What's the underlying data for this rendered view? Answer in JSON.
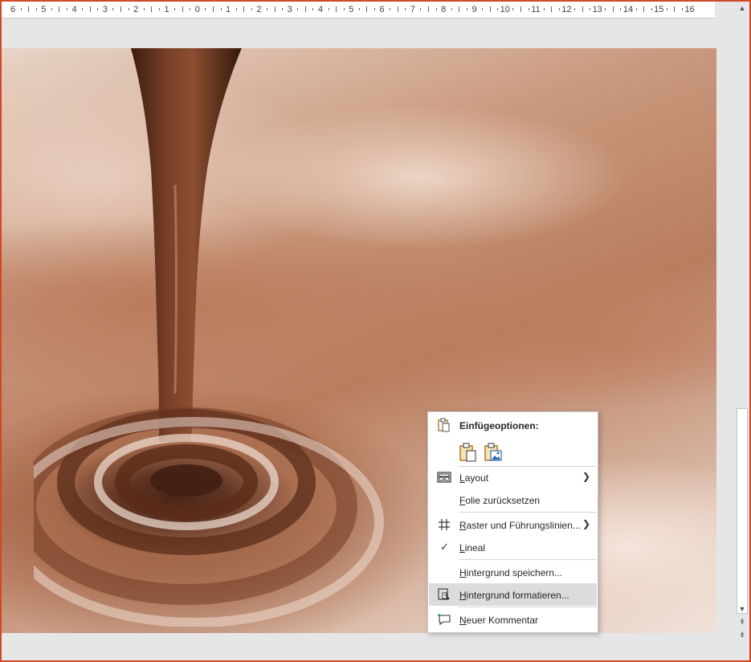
{
  "ruler": {
    "labels": [
      "6",
      "5",
      "4",
      "3",
      "2",
      "1",
      "0",
      "1",
      "2",
      "3",
      "4",
      "5",
      "6",
      "7",
      "8",
      "9",
      "10",
      "11",
      "12",
      "13",
      "14",
      "15",
      "16"
    ]
  },
  "context_menu": {
    "paste_options_title": "Einfügeoptionen:",
    "paste_options": [
      {
        "name": "keep-source-formatting",
        "icon": "clipboard-icon"
      },
      {
        "name": "picture",
        "icon": "clipboard-picture-icon"
      }
    ],
    "items": {
      "layout": {
        "label": "Layout",
        "access_key": "L",
        "rest": "ayout",
        "has_submenu": true,
        "icon": "layout-icon"
      },
      "reset_slide": {
        "label": "Folie zurücksetzen",
        "access_key": "F",
        "rest": "olie zurücksetzen"
      },
      "grid_guides": {
        "label": "Raster und Führungslinien...",
        "access_key": "R",
        "rest": "aster und Führungslinien...",
        "has_submenu": true,
        "icon": "grid-icon"
      },
      "ruler": {
        "label": "Lineal",
        "access_key": "L",
        "rest": "ineal",
        "checked": true,
        "icon": "checkmark-icon"
      },
      "save_background": {
        "label": "Hintergrund speichern...",
        "access_key": "H",
        "rest": "intergrund speichern..."
      },
      "format_background": {
        "label": "Hintergrund formatieren...",
        "access_key": "H",
        "rest": "intergrund formatieren...",
        "highlighted": true,
        "icon": "format-background-icon"
      },
      "new_comment": {
        "label": "Neuer Kommentar",
        "access_key": "N",
        "rest": "euer Kommentar",
        "icon": "new-comment-icon"
      }
    }
  },
  "colors": {
    "accent_border": "#d24726",
    "menu_highlight": "#dcdcdc",
    "chocolate_dark": "#4a2415"
  }
}
